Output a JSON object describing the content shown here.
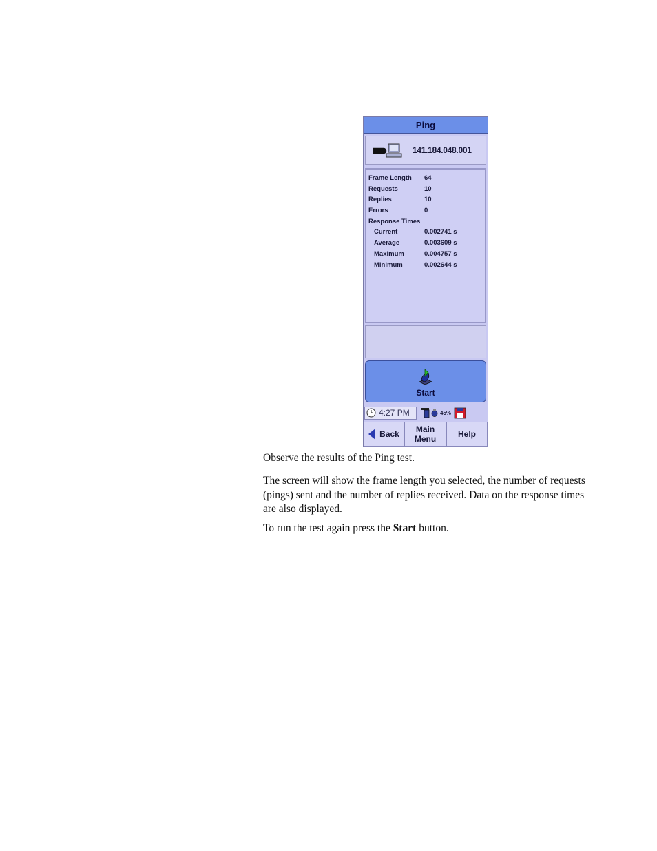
{
  "device": {
    "title": "Ping",
    "target_address": "141.184.048.001",
    "results": [
      {
        "label": "Frame Length",
        "value": "64",
        "indent": false
      },
      {
        "label": "Requests",
        "value": "10",
        "indent": false
      },
      {
        "label": "Replies",
        "value": "10",
        "indent": false
      },
      {
        "label": "Errors",
        "value": "0",
        "indent": false
      },
      {
        "label": "Response Times",
        "value": "",
        "indent": false
      },
      {
        "label": "Current",
        "value": "0.002741 s",
        "indent": true
      },
      {
        "label": "Average",
        "value": "0.003609 s",
        "indent": true
      },
      {
        "label": "Maximum",
        "value": "0.004757 s",
        "indent": true
      },
      {
        "label": "Minimum",
        "value": "0.002644 s",
        "indent": true
      }
    ],
    "start_label": "Start",
    "status": {
      "time": "4:27 PM",
      "battery_percent": "45%"
    },
    "nav": {
      "back": "Back",
      "main_menu": "Main\nMenu",
      "help": "Help"
    },
    "colors": {
      "accent": "#6b8fe8",
      "panel": "#cfcff4"
    }
  },
  "text": {
    "p1": "Observe the results of the Ping test.",
    "p2": "The screen will show the frame length you selected, the number of requests (pings) sent and the number of replies received. Data on the response times are also displayed.",
    "p3_before": "To run the test again press the ",
    "p3_bold": "Start",
    "p3_after": " button."
  }
}
